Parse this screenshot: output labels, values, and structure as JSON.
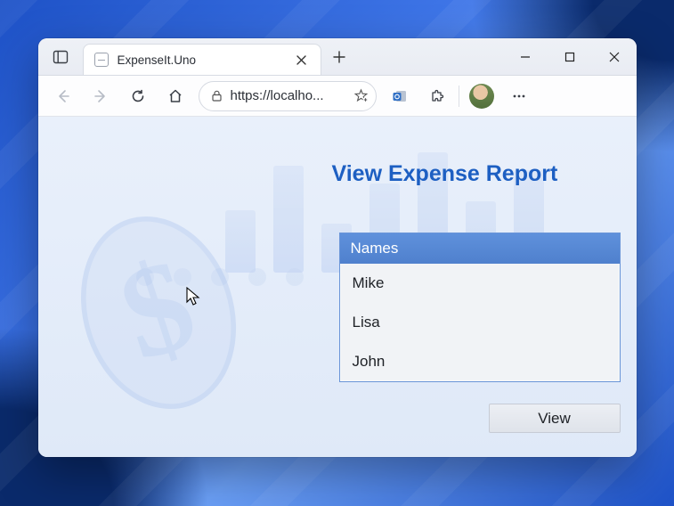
{
  "tab": {
    "title": "ExpenseIt.Uno"
  },
  "address": {
    "url": "https://localho..."
  },
  "page": {
    "title": "View Expense Report",
    "listHeader": "Names",
    "names": [
      "Mike",
      "Lisa",
      "John"
    ],
    "viewButton": "View"
  }
}
